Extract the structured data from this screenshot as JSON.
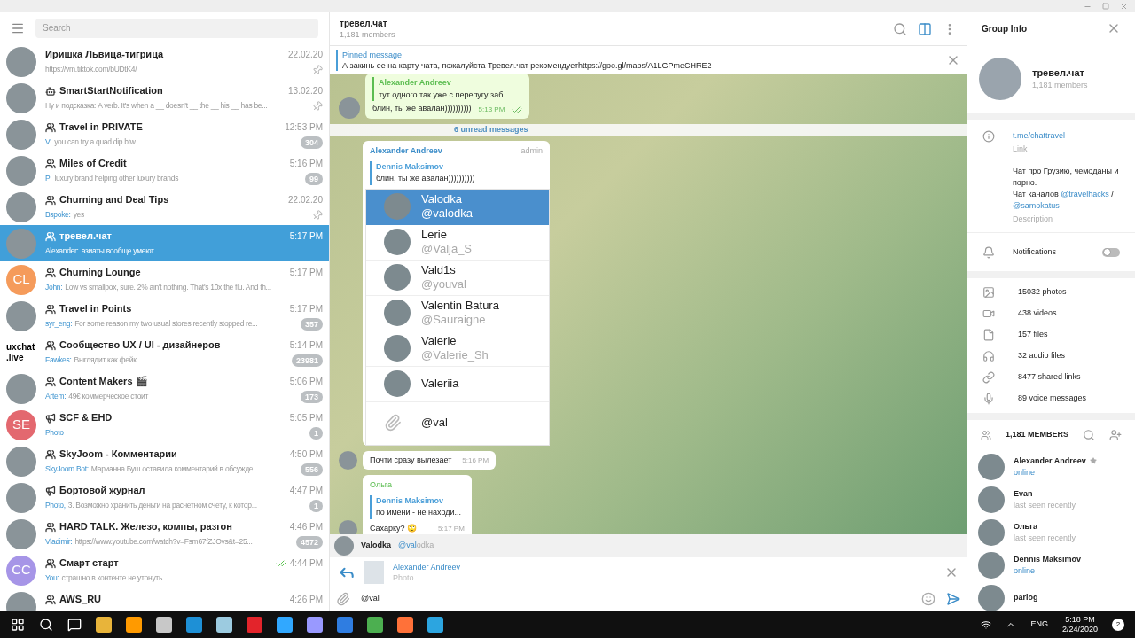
{
  "sidebar": {
    "search": {
      "placeholder": "Search"
    },
    "chats": [
      {
        "name": "Иришка Львица-тигрица",
        "kind": "person",
        "time": "22.02.20",
        "preview": "https://vm.tiktok.com/bUDtK4/",
        "pinned": true,
        "read": false,
        "selected": false,
        "avatar": {
          "kind": "photo"
        }
      },
      {
        "name": "SmartStartNotification",
        "kind": "bot",
        "time": "13.02.20",
        "preview": "Ну и подсказка:  A verb. It's when a __ doesn't __ the __ his __ has be...",
        "pinned": true,
        "read": false,
        "selected": false,
        "avatar": {
          "kind": "photo"
        }
      },
      {
        "name": "Travel in PRIVATE",
        "kind": "group",
        "time": "12:53 PM",
        "sender": "V:",
        "preview": "you can try a quad dip btw",
        "unread": "304",
        "pinned": false,
        "read": false,
        "selected": false,
        "avatar": {
          "kind": "photo"
        }
      },
      {
        "name": "Miles of Credit",
        "kind": "group",
        "time": "5:16 PM",
        "sender": "P:",
        "preview": "luxury brand helping other luxury brands",
        "unread": "99",
        "pinned": false,
        "read": false,
        "selected": false,
        "avatar": {
          "kind": "photo"
        }
      },
      {
        "name": "Churning and Deal Tips",
        "kind": "group",
        "time": "22.02.20",
        "sender": "Bspoke:",
        "preview": "yes",
        "pinned": true,
        "read": false,
        "selected": false,
        "avatar": {
          "kind": "photo"
        }
      },
      {
        "name": "тревел.чат",
        "kind": "group",
        "time": "5:17 PM",
        "sender": "Alexander:",
        "preview": "азиаты вообще умеют",
        "pinned": false,
        "read": false,
        "selected": true,
        "avatar": {
          "kind": "photo"
        }
      },
      {
        "name": "Churning Lounge",
        "kind": "group",
        "time": "5:17 PM",
        "sender": "John:",
        "preview": "Low vs smallpox, sure. 2% ain't nothing. That's 10x the flu.  And th...",
        "pinned": false,
        "read": false,
        "selected": false,
        "avatar": {
          "kind": "initials",
          "text": "CL",
          "color": "#f59b5b"
        }
      },
      {
        "name": "Travel in Points",
        "kind": "group",
        "time": "5:17 PM",
        "sender": "syr_eng:",
        "preview": "For some reason my two usual stores recently stopped re...",
        "unread": "357",
        "pinned": false,
        "read": false,
        "selected": false,
        "avatar": {
          "kind": "photo"
        }
      },
      {
        "name": "Сообщество UX / UI - дизайнеров",
        "kind": "group",
        "time": "5:14 PM",
        "sender": "Fawkes:",
        "preview": "Выглядит как фейк",
        "unread": "23981",
        "pinned": false,
        "read": false,
        "selected": false,
        "avatar": {
          "kind": "text",
          "lines": [
            "uxchat",
            ".live"
          ]
        }
      },
      {
        "name": "Content Makers 🎬",
        "kind": "group",
        "time": "5:06 PM",
        "sender": "Artem:",
        "preview": "49€ коммерческое стоит",
        "unread": "173",
        "pinned": false,
        "read": false,
        "selected": false,
        "avatar": {
          "kind": "photo"
        }
      },
      {
        "name": "SCF & EHD",
        "kind": "channel",
        "time": "5:05 PM",
        "sender": "Photo",
        "unread": "1",
        "pinned": false,
        "read": false,
        "selected": false,
        "avatar": {
          "kind": "initials",
          "text": "SE",
          "color": "#e3686f"
        }
      },
      {
        "name": "SkyJoom - Комментарии",
        "kind": "group",
        "time": "4:50 PM",
        "sender": "SkyJoom Bot:",
        "preview": "Марианна Буш оставила комментарий в обсужде...",
        "unread": "556",
        "pinned": false,
        "read": false,
        "selected": false,
        "avatar": {
          "kind": "photo"
        }
      },
      {
        "name": "Бортовой журнал",
        "kind": "channel",
        "time": "4:47 PM",
        "sender": "Photo,",
        "preview": "3. Возможно хранить деньги на расчетном счету, к котор...",
        "unread": "1",
        "pinned": false,
        "read": false,
        "selected": false,
        "avatar": {
          "kind": "photo"
        }
      },
      {
        "name": "HARD TALK. Железо, компы, разгон",
        "kind": "group",
        "time": "4:46 PM",
        "sender": "Vladimir:",
        "preview": "https://www.youtube.com/watch?v=Fsm67fZJOvs&t=25...",
        "unread": "4572",
        "pinned": false,
        "read": false,
        "selected": false,
        "avatar": {
          "kind": "photo"
        }
      },
      {
        "name": "Смарт старт",
        "kind": "group",
        "time": "4:44 PM",
        "sender": "You:",
        "preview": "страшно в контенте не утонуть",
        "pinned": false,
        "read": true,
        "selected": false,
        "avatar": {
          "kind": "initials",
          "text": "CC",
          "color": "#a695e7"
        }
      },
      {
        "name": "AWS_RU",
        "kind": "group",
        "time": "4:26 PM",
        "pinned": false,
        "read": false,
        "selected": false,
        "avatar": {
          "kind": "photo"
        }
      }
    ]
  },
  "chat": {
    "title": "тревел.чат",
    "subtitle": "1,181 members",
    "pinned": {
      "label": "Pinned message",
      "text": "А закинь ее на карту чата, пожалуйста Тревел.чат рекомендуетhttps://goo.gl/maps/A1LGPmeCHRE2"
    },
    "messages": [
      {
        "kind": "outgoing",
        "reply_name": "Alexander Andreev",
        "reply_text": "тут одного так уже с перепугу заб...",
        "text": "блин, ты же авалан))))))))))",
        "time": "5:13 PM",
        "read": true
      },
      {
        "kind": "divider",
        "text": "6 unread messages"
      },
      {
        "kind": "photo",
        "sender": "Alexander Andreev",
        "role": "admin",
        "reply_name": "Dennis Maksimov",
        "reply_text": "блин, ты же авалан))))))))))",
        "mentions": [
          {
            "name": "Valodka",
            "username": "@valodka",
            "selected": true
          },
          {
            "name": "Lerie",
            "username": "@Valja_S",
            "selected": false
          },
          {
            "name": "Vald1s",
            "username": "@youval",
            "selected": false
          },
          {
            "name": "Valentin Batura",
            "username": "@Sauraigne",
            "selected": false
          },
          {
            "name": "Valerie",
            "username": "@Valerie_Sh",
            "selected": false
          },
          {
            "name": "Valeriia",
            "selected": false
          }
        ],
        "input": "@val"
      },
      {
        "kind": "text",
        "text": "Почти сразу вылезает",
        "time": "5:16 PM"
      },
      {
        "kind": "reply",
        "sender": "Ольга",
        "reply_name": "Dennis Maksimov",
        "reply_text": "по имени - не находи...",
        "text": "Сахарку? 🙄",
        "time": "5:17 PM"
      }
    ],
    "suggestion": {
      "name": "Valodka",
      "match": "@val",
      "rest": "odka"
    },
    "reply": {
      "name": "Alexander Andreev",
      "text": "Photo"
    },
    "input": {
      "value": "@val"
    }
  },
  "info": {
    "title": "Group Info",
    "name": "тревел.чат",
    "subtitle": "1,181 members",
    "link": {
      "value": "t.me/chattravel",
      "label": "Link"
    },
    "description": {
      "lines": [
        "Чат про Грузию, чемоданы и порно.",
        "Чат каналов **@travelhacks** / **@samokatus**"
      ],
      "label": "Description"
    },
    "notifications": {
      "label": "Notifications",
      "on": false
    },
    "media": [
      {
        "kind": "photos",
        "text": "15032 photos"
      },
      {
        "kind": "videos",
        "text": "438 videos"
      },
      {
        "kind": "files",
        "text": "157 files"
      },
      {
        "kind": "audio",
        "text": "32 audio files"
      },
      {
        "kind": "links",
        "text": "8477 shared links"
      },
      {
        "kind": "voice",
        "text": "89 voice messages"
      }
    ],
    "members_title": "1,181 MEMBERS",
    "members": [
      {
        "name": "Alexander Andreev",
        "status": "online",
        "online": true,
        "starred": true
      },
      {
        "name": "Evan",
        "status": "last seen recently",
        "online": false,
        "starred": false
      },
      {
        "name": "Ольга",
        "status": "last seen recently",
        "online": false,
        "starred": false
      },
      {
        "name": "Dennis Maksimov",
        "status": "online",
        "online": true,
        "starred": false
      },
      {
        "name": "parlog",
        "starred": false
      }
    ]
  },
  "taskbar": {
    "language": "ENG",
    "time": "5:18 PM",
    "date": "2/24/2020",
    "notifications": "2"
  }
}
